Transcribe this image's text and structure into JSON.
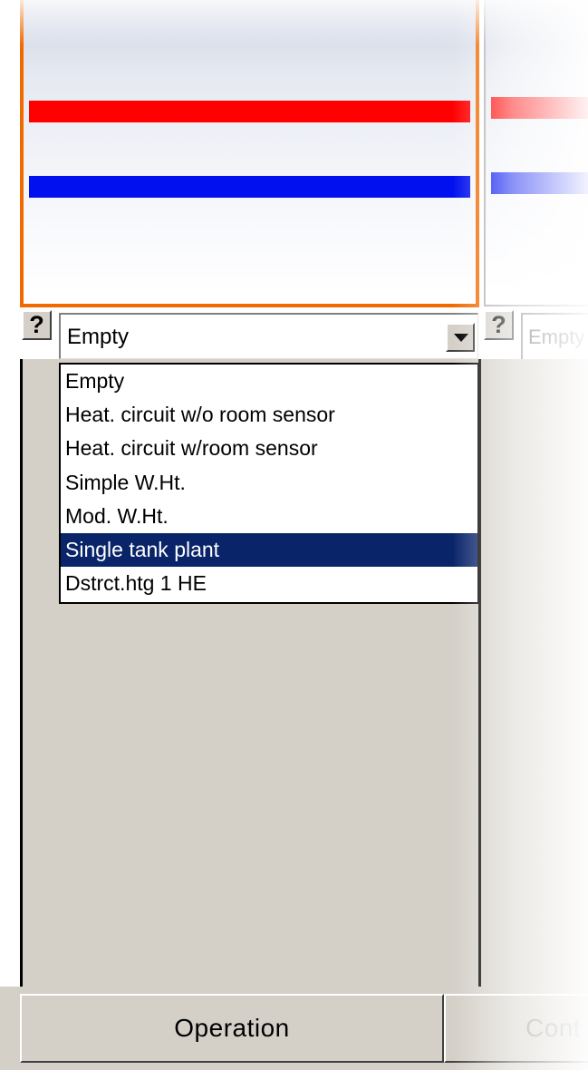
{
  "slot1": {
    "help_label": "?",
    "combo_value": "Empty",
    "options": [
      "Empty",
      "Heat. circuit w/o room sensor",
      "Heat. circuit w/room sensor",
      "Simple W.Ht.",
      "Mod. W.Ht.",
      "Single tank plant",
      "Dstrct.htg 1 HE"
    ],
    "highlighted_option": "Single tank plant"
  },
  "slot2": {
    "help_label": "?",
    "combo_value": "Empty"
  },
  "bottom": {
    "operation_label": "Operation",
    "cont_label": "Cont"
  },
  "colors": {
    "active_border": "#f06a00",
    "supply_pipe": "#ff0000",
    "return_pipe": "#0010ee",
    "selection": "#0a246a",
    "face": "#d4d0c8"
  }
}
